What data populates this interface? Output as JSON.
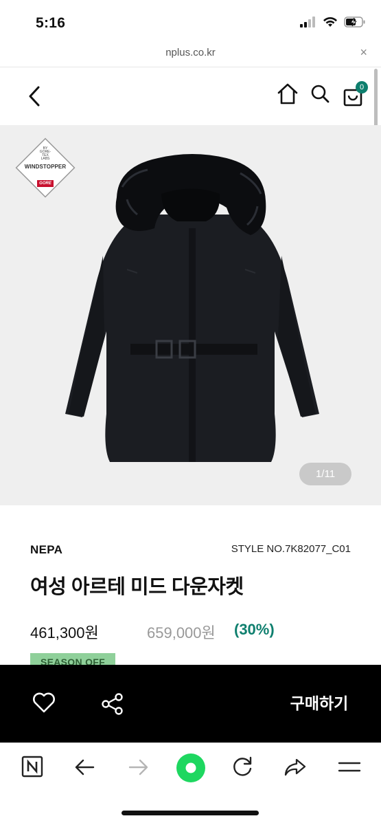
{
  "status_bar": {
    "time": "5:16"
  },
  "url_bar": {
    "url": "nplus.co.kr",
    "close_glyph": "×"
  },
  "header": {
    "cart_count": "0",
    "icons": [
      "chevron-left-icon",
      "home-icon",
      "search-icon",
      "shopping-bag-icon"
    ]
  },
  "product_image": {
    "badge_by_text": "BY GORE-TEX LABS",
    "badge_label": "WINDSTOPPER",
    "badge_logo": "GORE",
    "counter": "1/11"
  },
  "product": {
    "brand": "NEPA",
    "style_no": "STYLE NO.7K82077_C01",
    "title": "여성 아르테 미드 다운자켓",
    "price": "461,300원",
    "original_price": "659,000원",
    "discount": "(30%)",
    "season_badge": "SEASON OFF"
  },
  "purchase_bar": {
    "buy_label": "구매하기"
  },
  "browser_toolbar": {
    "icons": [
      "n-tabs-icon",
      "back-arrow-icon",
      "forward-arrow-icon",
      "green-dot-icon",
      "refresh-icon",
      "share-arrow-icon",
      "menu-icon"
    ]
  },
  "colors": {
    "accent_green": "#0e7f6e",
    "badge_green": "#8fd09a",
    "purchase_bar": "#000000",
    "browser_green": "#1ed760"
  }
}
